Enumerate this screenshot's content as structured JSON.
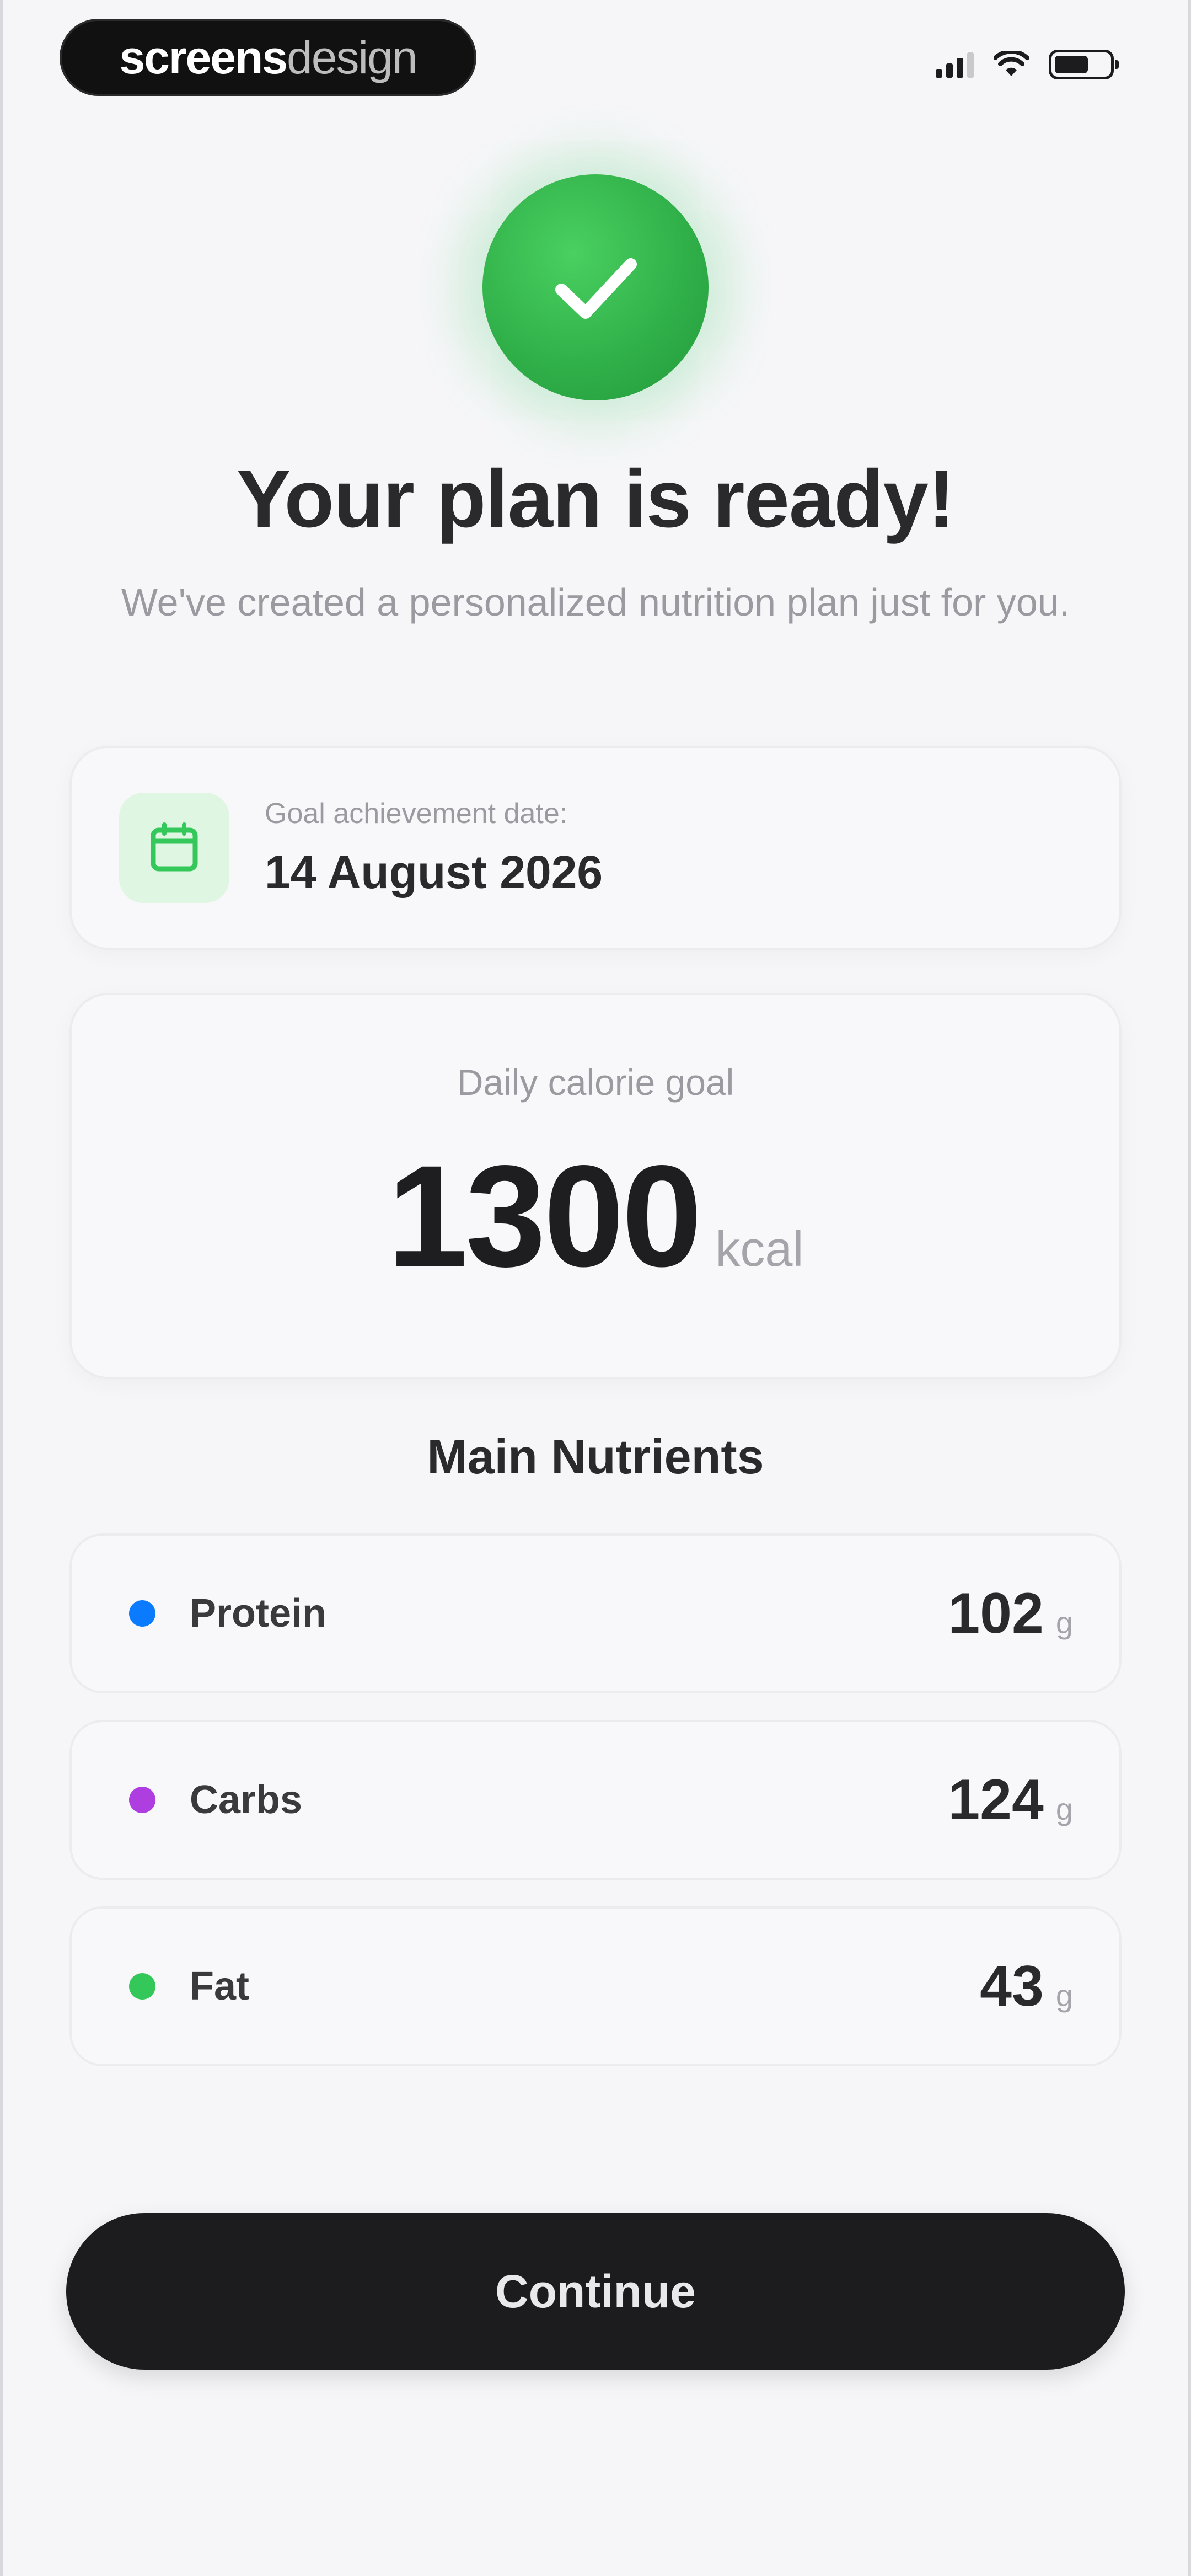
{
  "status_bar": {
    "brand_strong": "screens",
    "brand_light": "design"
  },
  "header": {
    "title": "Your plan is ready!",
    "subtitle": "We've created a personalized nutrition plan just for you.",
    "icon": "checkmark-icon",
    "accent_color": "#34C759"
  },
  "goal": {
    "label": "Goal achievement date:",
    "date": "14 August 2026",
    "icon": "calendar-icon"
  },
  "calories": {
    "label": "Daily calorie goal",
    "value": "1300",
    "unit": "kcal"
  },
  "nutrients": {
    "title": "Main Nutrients",
    "items": [
      {
        "name": "Protein",
        "value": "102",
        "unit": "g",
        "color": "#0A7AFF"
      },
      {
        "name": "Carbs",
        "value": "124",
        "unit": "g",
        "color": "#AF3EE0"
      },
      {
        "name": "Fat",
        "value": "43",
        "unit": "g",
        "color": "#34C759"
      }
    ]
  },
  "actions": {
    "continue_label": "Continue"
  }
}
